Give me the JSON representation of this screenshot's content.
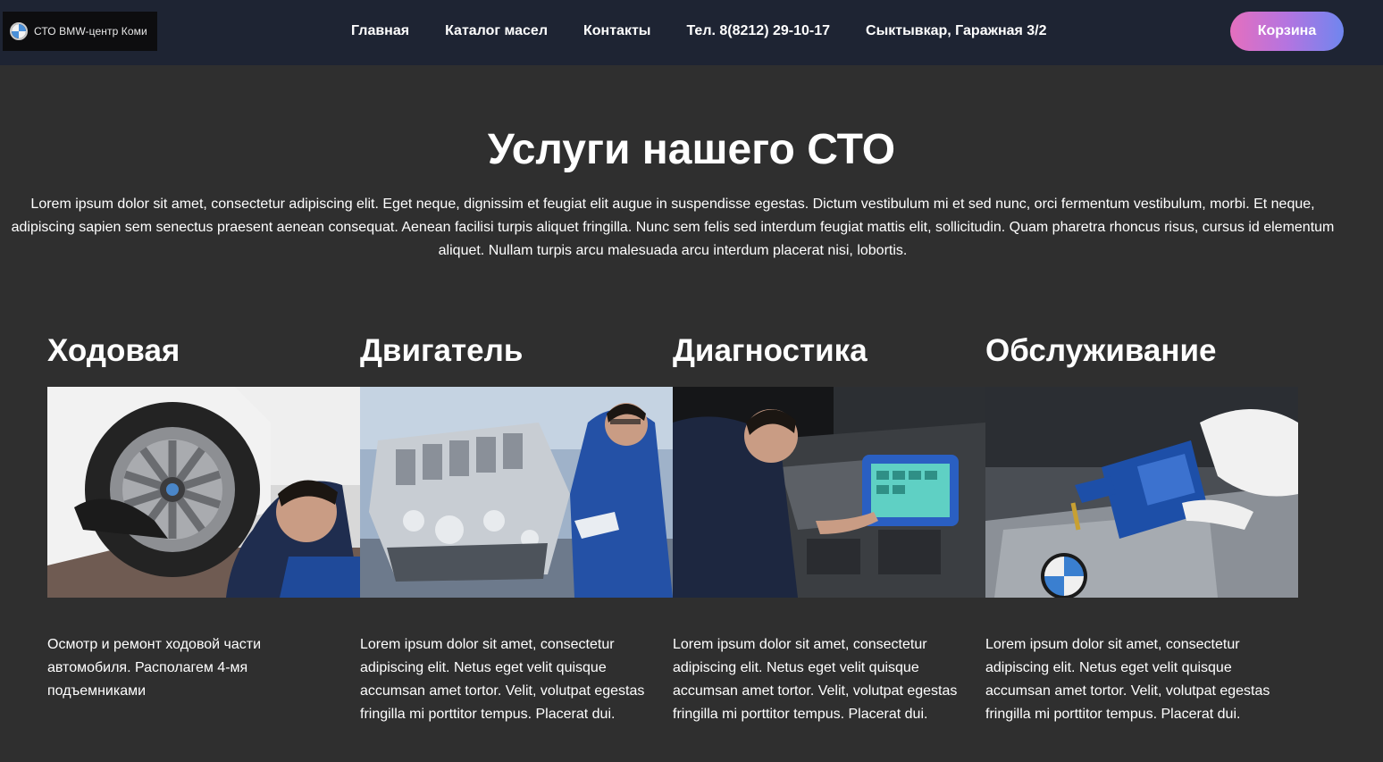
{
  "header": {
    "logo_text": "СТО BMW-центр Коми",
    "nav": [
      {
        "label": "Главная"
      },
      {
        "label": "Каталог масел"
      },
      {
        "label": "Контакты"
      },
      {
        "label": "Тел. 8(8212) 29-10-17"
      },
      {
        "label": "Сыктывкар, Гаражная 3/2"
      }
    ],
    "cart_label": "Корзина"
  },
  "intro": {
    "title": "Услуги нашего СТО",
    "text": "Lorem ipsum dolor sit amet, consectetur adipiscing elit. Eget neque, dignissim et feugiat elit augue in suspendisse egestas. Dictum vestibulum mi et sed nunc, orci fermentum vestibulum, morbi. Et neque, adipiscing sapien sem senectus praesent aenean consequat. Aenean facilisi turpis aliquet fringilla. Nunc sem felis sed interdum feugiat mattis elit, sollicitudin. Quam pharetra rhoncus risus, cursus id elementum aliquet. Nullam turpis arcu malesuada arcu interdum placerat nisi, lobortis."
  },
  "services": [
    {
      "title": "Ходовая",
      "image_icon": "wheel-repair-photo",
      "description": "Осмотр и ремонт ходовой части автомобиля. Располагем 4-мя подъемниками"
    },
    {
      "title": "Двигатель",
      "image_icon": "engine-repair-photo",
      "description": "Lorem ipsum dolor sit amet, consectetur adipiscing elit. Netus eget velit quisque accumsan amet tortor. Velit, volutpat egestas fringilla mi porttitor tempus. Placerat dui."
    },
    {
      "title": "Диагностика",
      "image_icon": "diagnostics-photo",
      "description": "Lorem ipsum dolor sit amet, consectetur adipiscing elit. Netus eget velit quisque accumsan amet tortor. Velit, volutpat egestas fringilla mi porttitor tempus. Placerat dui."
    },
    {
      "title": "Обслуживание",
      "image_icon": "oil-change-photo",
      "description": "Lorem ipsum dolor sit amet, consectetur adipiscing elit. Netus eget velit quisque accumsan amet tortor. Velit, volutpat egestas fringilla mi porttitor tempus. Placerat dui."
    }
  ],
  "colors": {
    "page_background": "#2f2f2f",
    "header_background": "#1e2433",
    "cart_gradient_start": "#e56fbe",
    "cart_gradient_end": "#6f86ef",
    "text": "#ffffff"
  }
}
